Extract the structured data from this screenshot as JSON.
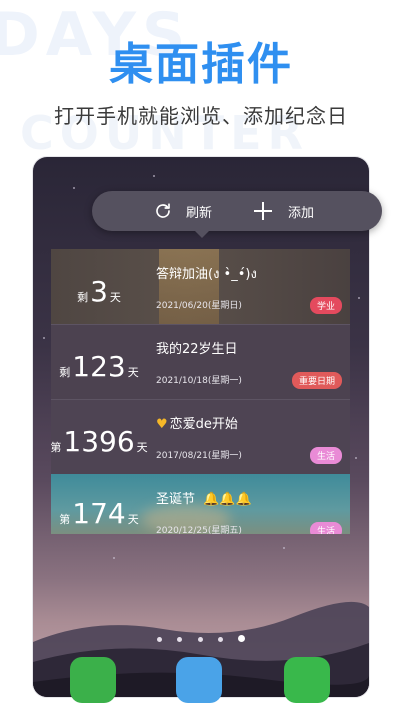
{
  "bg_text": [
    "DAYS",
    "COUNTER"
  ],
  "hero": {
    "title": "桌面插件",
    "subtitle": "打开手机就能浏览、添加纪念日"
  },
  "popup": {
    "refresh_label": "刷新",
    "add_label": "添加"
  },
  "cards": [
    {
      "prefix": "剩",
      "number": "3",
      "unit": "天",
      "title": "答辩加油(ง •̀_•́)ง",
      "date": "2021/06/20(星期日)",
      "tag": "学业",
      "tag_color": "#e44a5e"
    },
    {
      "prefix": "剩",
      "number": "123",
      "unit": "天",
      "title": "我的22岁生日",
      "date": "2021/10/18(星期一)",
      "tag": "重要日期",
      "tag_color": "#e05a5a"
    },
    {
      "prefix": "第",
      "number": "1396",
      "unit": "天",
      "title": "恋爱de开始",
      "date": "2017/08/21(星期一)",
      "tag": "生活",
      "tag_color": "#e98bd6"
    },
    {
      "prefix": "第",
      "number": "174",
      "unit": "天",
      "title": "圣诞节",
      "date": "2020/12/25(星期五)",
      "tag": "生活",
      "tag_color": "#e98bd6"
    }
  ],
  "pager": {
    "count": 5,
    "active_index": 4
  },
  "colors": {
    "brand_blue": "#2f8ff0",
    "popup_bg": "#55515f"
  },
  "icons": {
    "refresh": "refresh-icon",
    "add": "plus-icon",
    "heart": "heart-icon",
    "bell": "bell-icon"
  }
}
